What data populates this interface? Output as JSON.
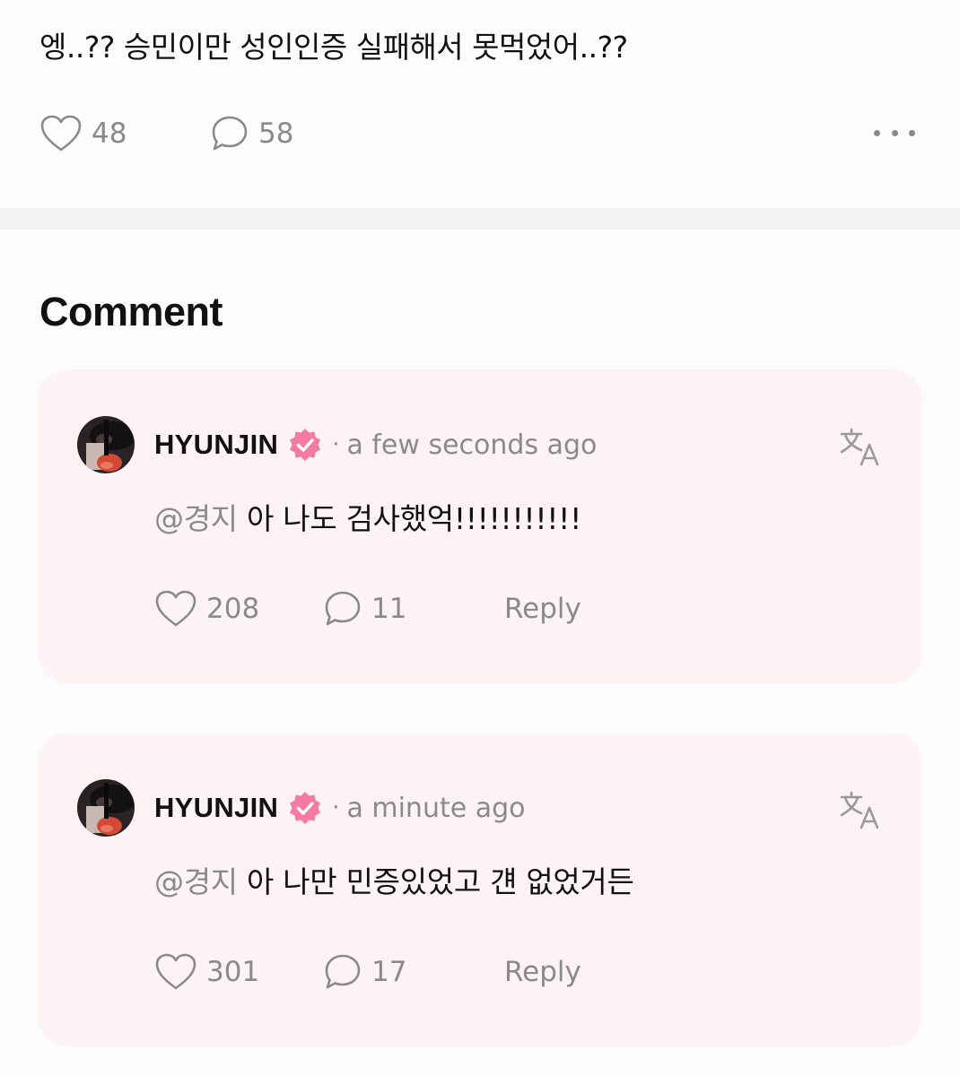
{
  "post": {
    "text": "엥..?? 승민이만 성인인증 실패해서 못먹었어..??",
    "likes": "48",
    "comments": "58"
  },
  "section_title": "Comment",
  "comments": [
    {
      "author": "HYUNJIN",
      "time": "a few seconds ago",
      "mention": "@경지",
      "text": " 아 나도 검사했억!!!!!!!!!!!",
      "likes": "208",
      "replies": "11",
      "reply_label": "Reply"
    },
    {
      "author": "HYUNJIN",
      "time": "a minute ago",
      "mention": "@경지",
      "text": " 아 나만 민증있었고 걘 없었거든",
      "likes": "301",
      "replies": "17",
      "reply_label": "Reply"
    }
  ],
  "colors": {
    "badge": "#f57aa4",
    "card_bg": "#fdf3f5",
    "muted": "#8a8a8a"
  },
  "icons": [
    "heart-icon",
    "comment-icon",
    "more-icon",
    "verified-badge-icon",
    "translate-icon"
  ]
}
